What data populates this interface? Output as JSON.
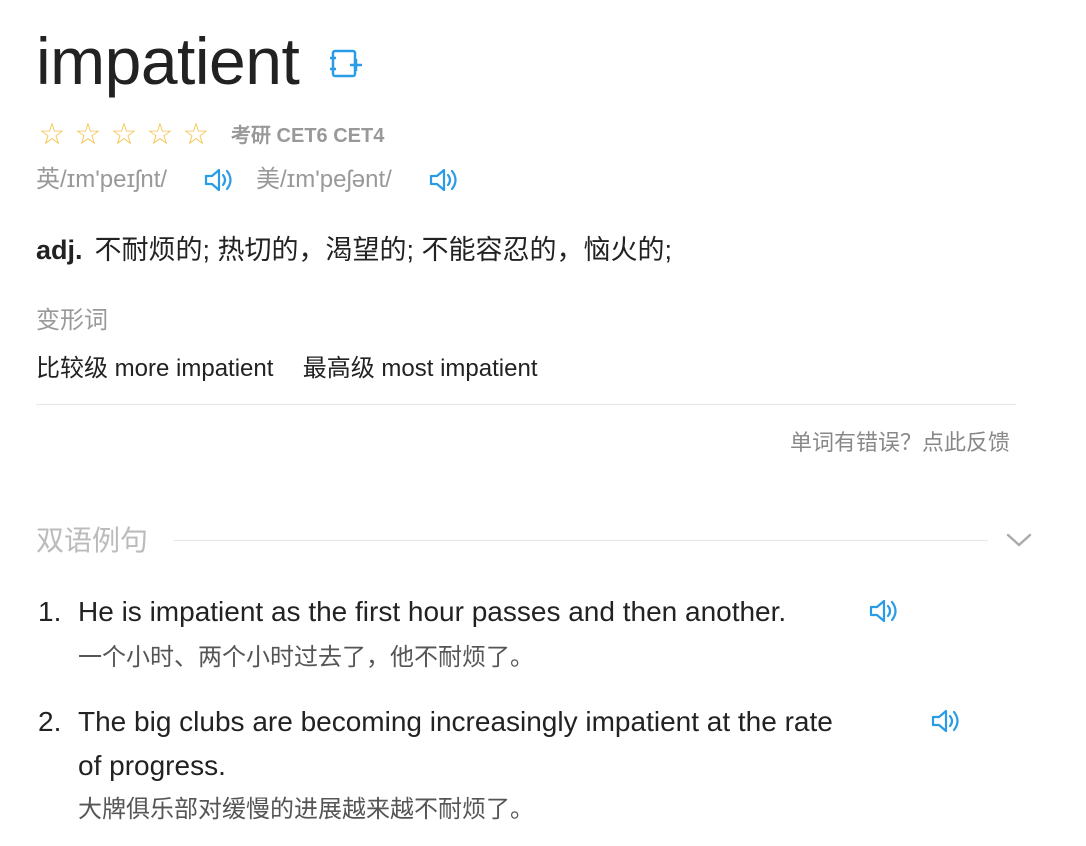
{
  "word": {
    "headword": "impatient",
    "stars": [
      "☆",
      "☆",
      "☆",
      "☆",
      "☆"
    ],
    "exam_tags": "考研 CET6 CET4"
  },
  "pronunciations": {
    "uk": "英/ɪm'peɪʃnt/",
    "us": "美/ɪm'peʃənt/"
  },
  "definition": {
    "pos": "adj.",
    "meaning": "不耐烦的; 热切的，渴望的; 不能容忍的，恼火的;"
  },
  "word_forms": {
    "title": "变形词",
    "comparative_label": "比较级",
    "comparative_value": "more impatient",
    "superlative_label": "最高级",
    "superlative_value": "most impatient"
  },
  "feedback_link": "单词有错误？点此反馈",
  "examples_section": {
    "title": "双语例句",
    "items": [
      {
        "num": "1.",
        "en_line1": "He is impatient as the first hour passes and then another.",
        "en_line2": "",
        "zh": "一个小时、两个小时过去了，他不耐烦了。"
      },
      {
        "num": "2.",
        "en_line1": "The big clubs are becoming increasingly impatient at the rate",
        "en_line2": "of progress.",
        "zh": "大牌俱乐部对缓慢的进展越来越不耐烦了。"
      }
    ]
  },
  "colors": {
    "accent_blue": "#2a9ce6",
    "star_gold": "#f5c24c",
    "muted_gray": "#999999"
  },
  "icons": {
    "add_wordbook": "add-to-wordbook-icon",
    "speaker": "speaker-icon",
    "collapse": "chevron-down-icon"
  }
}
